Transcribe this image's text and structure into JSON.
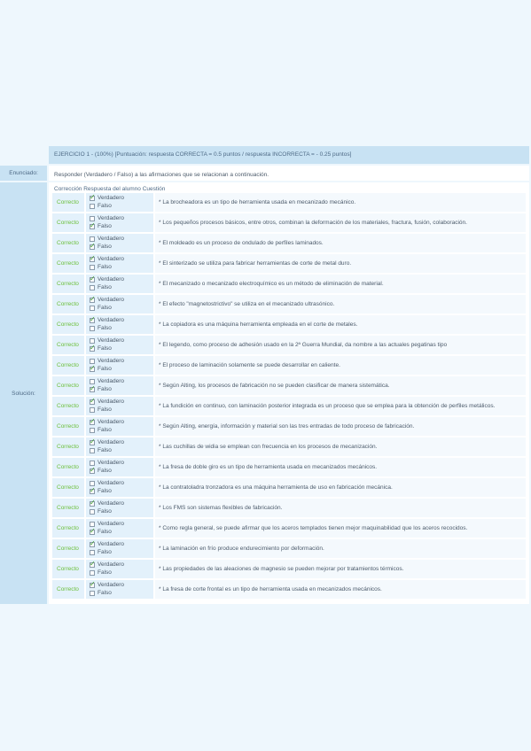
{
  "header": "EJERCICIO 1 - (100%) [Puntuación: respuesta CORRECTA = 0.5 puntos / respuesta INCORRECTA = - 0.25 puntos]",
  "enunciado": {
    "label": "Enunciado:",
    "text": "Responder (Verdadero / Falso) a las afirmaciones que se relacionan a continuación."
  },
  "solucion": {
    "label": "Solución:",
    "columns_header": "Corrección Respuesta del alumno Cuestión",
    "true_label": "Verdadero",
    "false_label": "Falso",
    "questions": [
      {
        "status": "Correcto",
        "answer": "true",
        "text": "* La brocheadora es un tipo de herramienta usada en mecanizado mecánico."
      },
      {
        "status": "Correcto",
        "answer": "false",
        "text": "* Los pequeños procesos básicos, entre otros, combinan la deformación de los materiales, fractura, fusión, colaboración."
      },
      {
        "status": "Correcto",
        "answer": "false",
        "text": "* El moldeado es un proceso de ondulado de perfiles laminados."
      },
      {
        "status": "Correcto",
        "answer": "true",
        "text": "* El sinterizado se utiliza para fabricar herramientas de corte de metal duro."
      },
      {
        "status": "Correcto",
        "answer": "true",
        "text": "* El mecanizado o mecanizado electroquímico es un método de eliminación de material."
      },
      {
        "status": "Correcto",
        "answer": "true",
        "text": "* El efecto \"magnetostrictivo\" se utiliza en el mecanizado ultrasónico."
      },
      {
        "status": "Correcto",
        "answer": "true",
        "text": "* La copiadora es una máquina herramienta empleada en el corte de metales."
      },
      {
        "status": "Correcto",
        "answer": "false",
        "text": "* El legendo, como proceso de adhesión usado en la 2ª Guerra Mundial, da nombre a las actuales pegatinas tipo"
      },
      {
        "status": "Correcto",
        "answer": "false",
        "text": "* El proceso de laminación solamente se puede desarrollar en caliente."
      },
      {
        "status": "Correcto",
        "answer": "false",
        "text": "* Según Alting, los procesos de fabricación no se pueden clasificar de manera sistemática."
      },
      {
        "status": "Correcto",
        "answer": "true",
        "text": "* La fundición en continuo, con laminación posterior integrada es un proceso que se emplea para la obtención de perfiles metálicos."
      },
      {
        "status": "Correcto",
        "answer": "true",
        "text": "* Según Alting, energía, información y material son las tres entradas de todo proceso de fabricación."
      },
      {
        "status": "Correcto",
        "answer": "true",
        "text": "* Las cuchillas de widia se emplean con frecuencia en los procesos de mecanización."
      },
      {
        "status": "Correcto",
        "answer": "false",
        "text": "* La fresa de doble giro es un tipo de herramienta usada en mecanizados mecánicos."
      },
      {
        "status": "Correcto",
        "answer": "false",
        "text": "* La contratoladra tronzadora es una máquina herramienta de uso en fabricación mecánica."
      },
      {
        "status": "Correcto",
        "answer": "true",
        "text": "* Los FMS son sistemas flexibles de fabricación."
      },
      {
        "status": "Correcto",
        "answer": "false",
        "text": "* Como regla general, se puede afirmar que los aceros templados tienen mejor maquinabilidad que los aceros recocidos."
      },
      {
        "status": "Correcto",
        "answer": "true",
        "text": "* La laminación en frío produce endurecimiento por deformación."
      },
      {
        "status": "Correcto",
        "answer": "true",
        "text": "* Las propiedades de las aleaciones de magnesio se pueden mejorar por tratamientos térmicos."
      },
      {
        "status": "Correcto",
        "answer": "true",
        "text": "* La fresa de corte frontal es un tipo de herramienta usada en mecanizados mecánicos."
      }
    ]
  }
}
